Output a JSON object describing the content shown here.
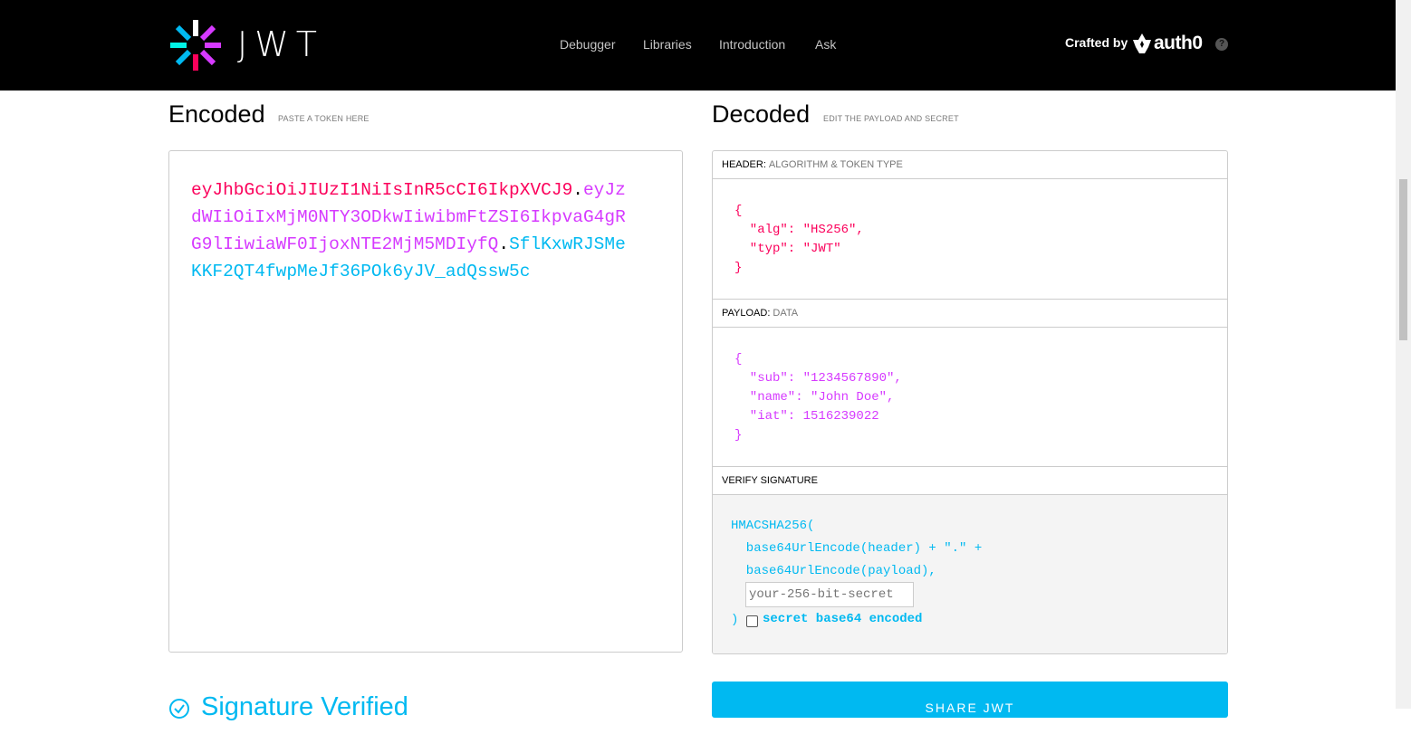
{
  "brand": {
    "logo_text": "JWT"
  },
  "nav": [
    {
      "label": "Debugger"
    },
    {
      "label": "Libraries"
    },
    {
      "label": "Introduction"
    },
    {
      "label": "Ask"
    }
  ],
  "crafted": {
    "label": "Crafted by",
    "company": "auth0",
    "help_icon": "question-circle-icon"
  },
  "encoded": {
    "title": "Encoded",
    "subtitle": "PASTE A TOKEN HERE",
    "token_header": "eyJhbGciOiJIUzI1NiIsInR5cCI6IkpXVCJ9",
    "dot": ".",
    "token_payload": "eyJzdWIiOiIxMjM0NTY3ODkwIiwibmFtZSI6IkpvaG4gRG9lIiwiaWF0IjoxNTE2MjM5MDIyfQ",
    "token_signature": "SflKxwRJSMeKKF2QT4fwpMeJf36POk6yJV_adQssw5c"
  },
  "decoded": {
    "title": "Decoded",
    "subtitle": "EDIT THE PAYLOAD AND SECRET",
    "header_label": "HEADER:",
    "header_muted": "ALGORITHM & TOKEN TYPE",
    "header_json": "{\n  \"alg\": \"HS256\",\n  \"typ\": \"JWT\"\n}",
    "payload_label": "PAYLOAD:",
    "payload_muted": "DATA",
    "payload_json": "{\n  \"sub\": \"1234567890\",\n  \"name\": \"John Doe\",\n  \"iat\": 1516239022\n}",
    "verify_label": "VERIFY SIGNATURE",
    "verify_code": "HMACSHA256(\n  base64UrlEncode(header) + \".\" +\n  base64UrlEncode(payload),",
    "secret_placeholder": "your-256-bit-secret",
    "close_paren": ")",
    "base64_label": "secret base64 encoded"
  },
  "status": {
    "signature_text": "Signature Verified"
  },
  "share_button": "SHARE JWT",
  "colors": {
    "header": "#fb015b",
    "payload": "#d63aff",
    "signature": "#00b9f1"
  }
}
